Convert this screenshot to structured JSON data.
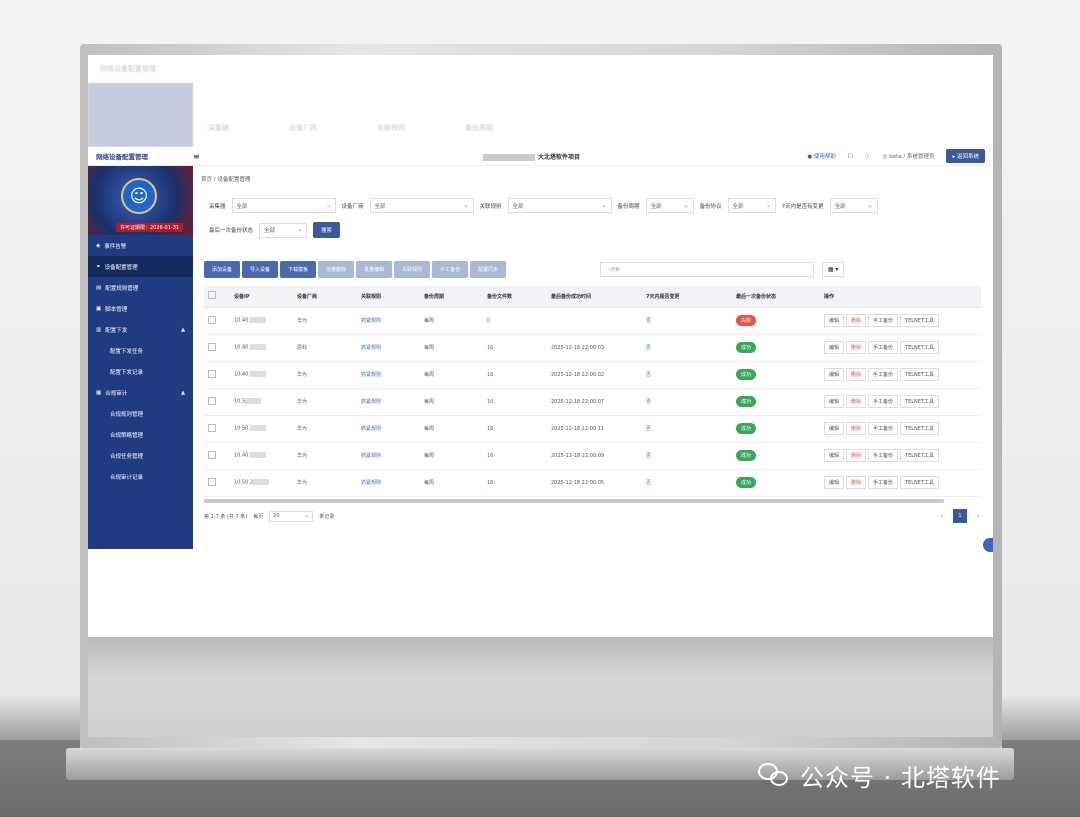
{
  "header": {
    "brand": "网络设备配置管理",
    "project_suffix": "大北塔软件项目",
    "help": "使用帮助",
    "user": "beta / 系统管理员",
    "back": "返回系统"
  },
  "sidebar": {
    "license": "许可证期限：2026-01-31",
    "items": [
      {
        "label": "事件告警"
      },
      {
        "label": "设备配置管理"
      },
      {
        "label": "配置规则管理"
      },
      {
        "label": "脚本管理"
      },
      {
        "label": "配置下发"
      },
      {
        "label": "配置下发任务"
      },
      {
        "label": "配置下发记录"
      },
      {
        "label": "合规审计"
      },
      {
        "label": "合规规则管理"
      },
      {
        "label": "合规策略管理"
      },
      {
        "label": "合规任务管理"
      },
      {
        "label": "合规审计记录"
      }
    ]
  },
  "breadcrumb": {
    "home": "首页",
    "sep": "/",
    "current": "设备配置管理"
  },
  "filters": {
    "f1": "采集器",
    "f2": "设备厂商",
    "f3": "关联规则",
    "f4": "备份周期",
    "f5": "备份协议",
    "f6": "7天内是否有变更",
    "f7": "最后一次备份状态",
    "all": "全部",
    "search": "搜索"
  },
  "toolbar": {
    "buttons": [
      "添加设备",
      "导入设备",
      "下载模板",
      "批量删除",
      "批量编辑",
      "关联规则",
      "手工备份",
      "配置同步"
    ],
    "search_placeholder": "搜索",
    "grid": "▦ ▾"
  },
  "table": {
    "headers": [
      "设备IP",
      "设备厂商",
      "关联规则",
      "备份周期",
      "备份文件数",
      "最后备份成功时间",
      "7天内是否变更",
      "最后一次备份状态",
      "操作"
    ],
    "rows": [
      {
        "ip": "10.40.",
        "vendor": "华为",
        "rule": "抓紧规则",
        "cycle": "每周",
        "files": "0",
        "time": "",
        "changed": "否",
        "status": "失败"
      },
      {
        "ip": "10.40.",
        "vendor": "思科",
        "rule": "抓紧规则",
        "cycle": "每周",
        "files": "16",
        "time": "2025-12-18 22:00:03",
        "changed": "否",
        "status": "成功"
      },
      {
        "ip": "10.40.",
        "vendor": "华为",
        "rule": "抓紧规则",
        "cycle": "每周",
        "files": "16",
        "time": "2025-12-18 22:00:02",
        "changed": "否",
        "status": "成功"
      },
      {
        "ip": "10.5",
        "vendor": "华为",
        "rule": "抓紧规则",
        "cycle": "每周",
        "files": "16",
        "time": "2025-12-18 22:00:07",
        "changed": "否",
        "status": "成功"
      },
      {
        "ip": "10.50.",
        "vendor": "华为",
        "rule": "抓紧规则",
        "cycle": "每周",
        "files": "16",
        "time": "2025-12-18 22:00:11",
        "changed": "否",
        "status": "成功"
      },
      {
        "ip": "10.40.",
        "vendor": "华为",
        "rule": "抓紧规则",
        "cycle": "每周",
        "files": "16",
        "time": "2025-12-18 22:00:09",
        "changed": "否",
        "status": "成功"
      },
      {
        "ip": "10.50.2",
        "vendor": "华为",
        "rule": "抓紧规则",
        "cycle": "每周",
        "files": "16",
        "time": "2025-12-18 22:00:05",
        "changed": "否",
        "status": "成功"
      }
    ],
    "ops": [
      "编辑",
      "删除",
      "手工备份",
      "TELNET工具"
    ]
  },
  "pager": {
    "summary": "第 1-7 条 (共 7 条)",
    "per_page_label": "每页",
    "per_page": "20",
    "records": "条记录",
    "page": "1",
    "prev": "‹",
    "next": "›"
  },
  "watermark": {
    "text": "公众号 · 北塔软件"
  }
}
